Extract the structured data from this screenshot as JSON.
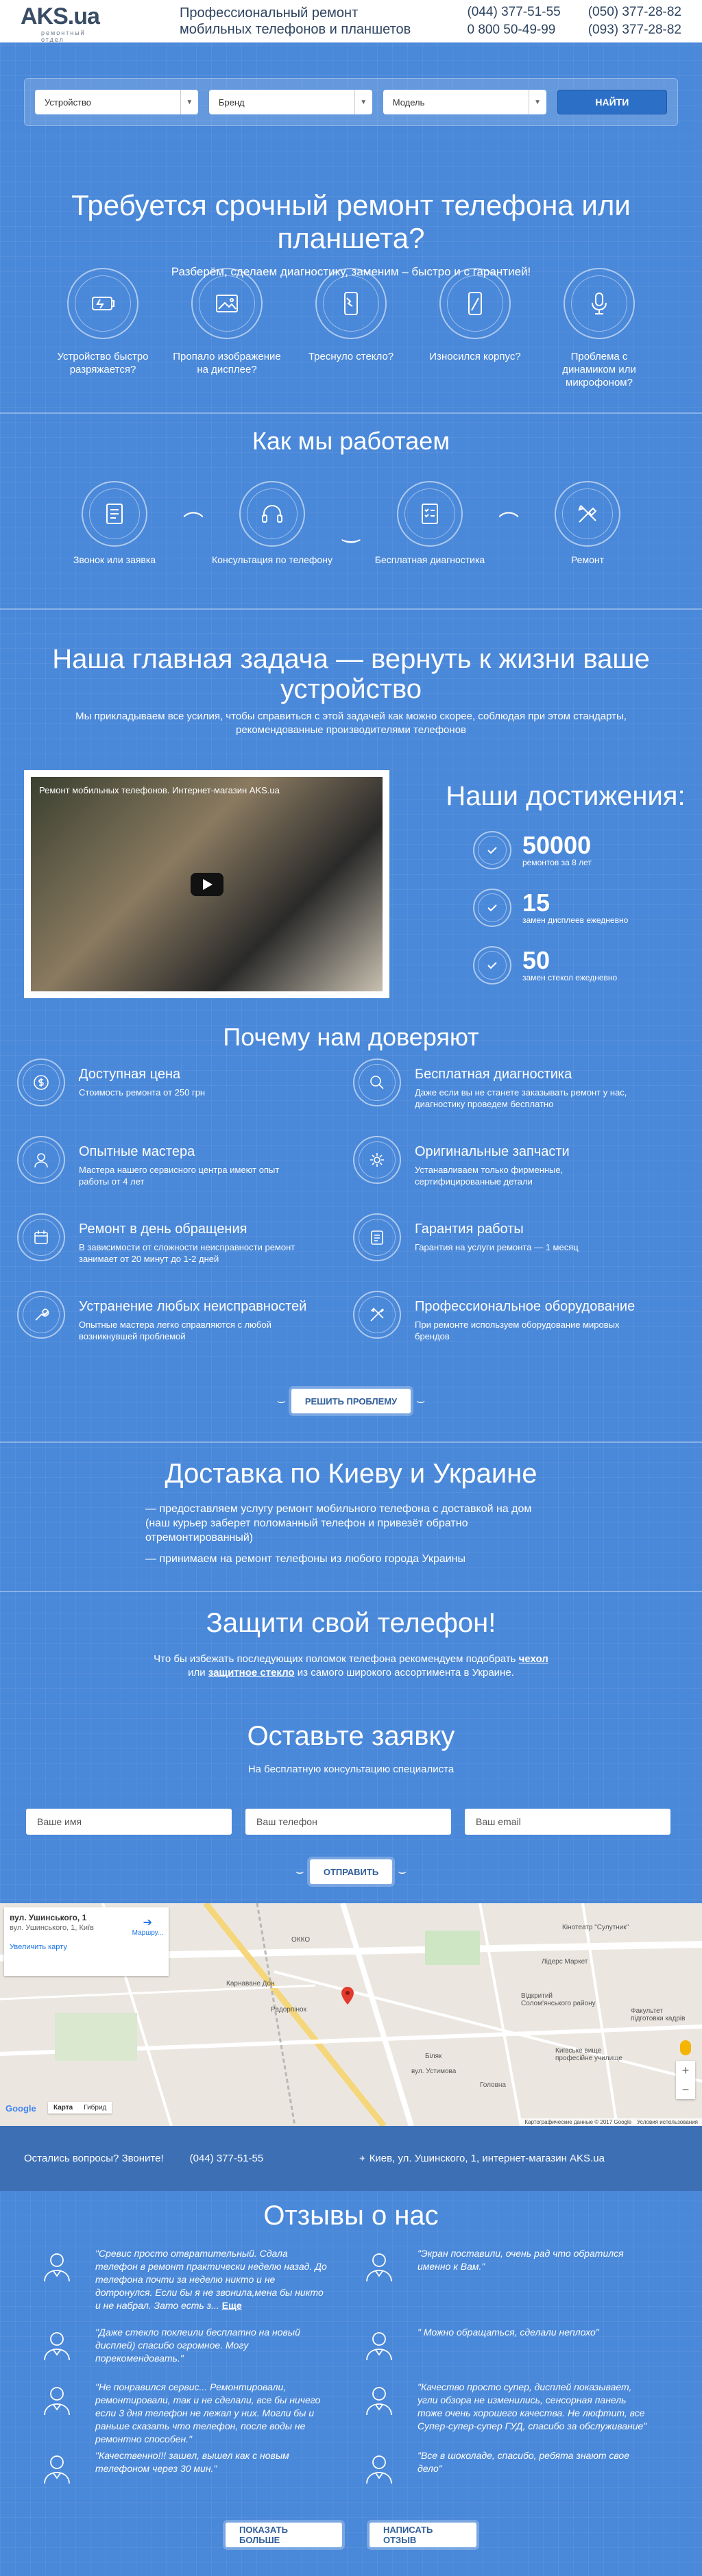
{
  "header": {
    "logo": "AKS.ua",
    "logo_sub": "ремонтный отдел",
    "tagline_1": "Профессиональный ремонт",
    "tagline_2": "мобильных телефонов и планшетов",
    "phones": [
      "(044) 377-51-55",
      "(050) 377-28-82",
      "0 800 50-49-99",
      "(093) 377-28-82"
    ]
  },
  "filters": {
    "device": "Устройство",
    "brand": "Бренд",
    "model": "Модель",
    "find": "НАЙТИ"
  },
  "urgent": {
    "title": "Требуется срочный ремонт телефона или планшета?",
    "subtitle": "Разберём, сделаем диагностику, заменим – быстро и с гарантией!",
    "items": [
      {
        "label": "Устройство быстро разряжается?",
        "icon": "battery-icon"
      },
      {
        "label": "Пропало изображение на дисплее?",
        "icon": "image-icon"
      },
      {
        "label": "Треснуло стекло?",
        "icon": "cracked-phone-icon"
      },
      {
        "label": "Износился корпус?",
        "icon": "phone-case-icon"
      },
      {
        "label": "Проблема с динамиком или микрофоном?",
        "icon": "microphone-icon"
      }
    ]
  },
  "process": {
    "title": "Как мы работаем",
    "steps": [
      {
        "label": "Звонок или заявка",
        "icon": "request-icon"
      },
      {
        "label": "Консультация по телефону",
        "icon": "headset-icon"
      },
      {
        "label": "Бесплатная диагностика",
        "icon": "checklist-icon"
      },
      {
        "label": "Ремонт",
        "icon": "tools-icon"
      }
    ]
  },
  "mission": {
    "title": "Наша главная задача — вернуть к жизни ваше устройство",
    "subtitle": "Мы прикладываем все усилия, чтобы справиться с этой задачей как можно скорее, соблюдая при этом стандарты, рекомендованные производителями телефонов"
  },
  "video": {
    "title": "Ремонт мобильных телефонов. Интернет-магазин AKS.ua"
  },
  "achievements": {
    "title": "Наши достижения:",
    "items": [
      {
        "num": "50000",
        "label": "ремонтов за 8 лет"
      },
      {
        "num": "15",
        "label": "замен дисплеев ежедневно"
      },
      {
        "num": "50",
        "label": "замен стекол ежедневно"
      }
    ]
  },
  "trust": {
    "title": "Почему нам доверяют",
    "items": [
      {
        "h": "Доступная цена",
        "p": "Стоимость ремонта от 250 грн",
        "icon": "coin-icon"
      },
      {
        "h": "Бесплатная диагностика",
        "p": "Даже если вы не станете заказывать ремонт у нас, диагностику проведем бесплатно",
        "icon": "magnifier-icon"
      },
      {
        "h": "Опытные мастера",
        "p": "Мастера нашего сервисного центра имеют опыт работы от 4 лет",
        "icon": "master-icon"
      },
      {
        "h": "Оригинальные запчасти",
        "p": "Устанавливаем только фирменные, сертифицированные детали",
        "icon": "gear-icon"
      },
      {
        "h": "Ремонт в день обращения",
        "p": "В зависимости от сложности неисправности ремонт занимает от 20 минут до 1-2 дней",
        "icon": "calendar-icon"
      },
      {
        "h": "Гарантия работы",
        "p": "Гарантия на услуги ремонта — 1 месяц",
        "icon": "guarantee-icon"
      },
      {
        "h": "Устранение любых неисправностей",
        "p": "Опытные мастера легко справляются с любой возникнувшей проблемой",
        "icon": "wrench-icon"
      },
      {
        "h": "Профессиональное оборудование",
        "p": "При ремонте используем оборудование мировых брендов",
        "icon": "equipment-icon"
      }
    ],
    "button": "РЕШИТЬ ПРОБЛЕМУ"
  },
  "delivery": {
    "title": "Доставка по Киеву и Украине",
    "line1": "— предоставляем услугу ремонт мобильного телефона с доставкой на дом (наш курьер заберет поломанный телефон и привезёт обратно отремонтированный)",
    "line2": "— принимаем на ремонт телефоны из любого города Украины"
  },
  "protect": {
    "title": "Защити свой телефон!",
    "text_1": "Что бы избежать последующих поломок телефона рекомендуем подобрать",
    "link_case": "чехол",
    "text_2": "или",
    "link_glass": "защитное стекло",
    "text_3": "из самого широкого ассортимента в Украине."
  },
  "form": {
    "title": "Оставьте заявку",
    "subtitle": "На бесплатную консультацию специалиста",
    "name": "Ваше имя",
    "phone": "Ваш телефон",
    "email": "Ваш email",
    "submit": "ОТПРАВИТЬ"
  },
  "map": {
    "card_title": "вул. Ушинського, 1",
    "card_addr": "вул. Ушинського, 1, Київ",
    "card_link": "Увеличить карту",
    "route": "Маршру...",
    "labels": [
      "ОККО",
      "Кінотеатр \"Сулутник\"",
      "Карнаване Дон",
      "Радорпінок",
      "Лідерс Маркет",
      "Відкритий Солом'янського району",
      "Факультет підготовки кадрів",
      "Київське вище професійне училище",
      "Біляк",
      "вул. Устимова",
      "Головна"
    ],
    "type_map": "Карта",
    "type_sat": "Гибрид",
    "google": "Google",
    "copyright": "Картографические данные © 2017 Google",
    "terms": "Условия использования"
  },
  "contacts": {
    "question": "Остались вопросы? Звоните!",
    "phone": "(044) 377-51-55",
    "address": "Киев, ул. Ушинского, 1, интернет-магазин AKS.ua"
  },
  "reviews": {
    "title": "Отзывы о нас",
    "items": [
      {
        "text": "\"Сревис просто отвратительный. Сдала телефон в ремонт практически неделю назад. До телефона почти за неделю никто и не дотронулся. Если бы я не звонила,мена бы никто и не набрал. Зато есть з...",
        "more": "Еще"
      },
      {
        "text": "\"Экран поставили, очень рад что обратился именно к Вам.\""
      },
      {
        "text": "\"Даже стекло поклеили бесплатно на новый дисплей) спасибо огромное. Могу порекомендовать.\""
      },
      {
        "text": "\" Можно обращаться, сделали неплохо\""
      },
      {
        "text": "\"Не понравился сервис... Ремонтировали, ремонтировали, так и не сделали, все бы ничего если 3 дня телефон не лежал у них. Могли бы и раньше сказать что телефон, после воды не ремонтно способен.\""
      },
      {
        "text": "\"Качество просто супер, дисплей показывает, угли обзора не изменились, сенсорная панель тоже очень хорошего качества. Не люфтит, все Супер-супер-супер ГУД, спасибо за обслуживание\""
      },
      {
        "text": "\"Качественно!!! зашел, вышел как с новым телефоном через 30 мин.\""
      },
      {
        "text": "\"Все в шоколаде, спасибо, ребята знают свое дело\""
      }
    ],
    "more": "ПОКАЗАТЬ БОЛЬШЕ",
    "write": "НАПИСАТЬ ОТЗЫВ"
  }
}
